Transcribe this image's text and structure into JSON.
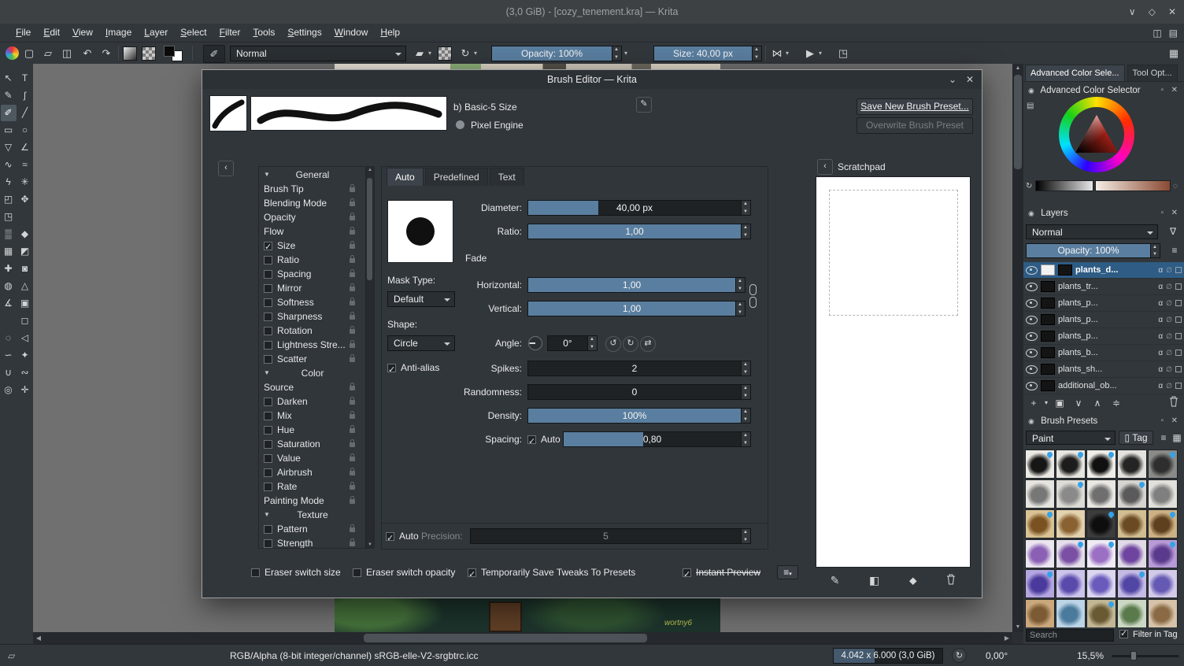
{
  "titlebar": {
    "title": "(3,0 GiB) - [cozy_tenement.kra] — Krita",
    "controls": {
      "shade": "∨",
      "maximize": "◇",
      "close": "✕"
    }
  },
  "menubar": {
    "items": [
      "File",
      "Edit",
      "View",
      "Image",
      "Layer",
      "Select",
      "Filter",
      "Tools",
      "Settings",
      "Window",
      "Help"
    ],
    "right_icons": {
      "detach": "◫",
      "canvas_only": "▤"
    }
  },
  "toolbar": {
    "icons": {
      "new": "▢",
      "open": "▱",
      "save": "◫",
      "undo": "↶",
      "redo": "↷",
      "eraser": "▰",
      "reload": "↻",
      "mirror_h": "⋈",
      "mirror_v": "▶",
      "wrap_around": "◳",
      "workspace": "▦",
      "brush_editor": "✐",
      "caret": "▾"
    },
    "blending_label": "Normal",
    "opacity": {
      "label": "Opacity: 100%",
      "fill": 1
    },
    "size": {
      "label": "Size: 40,00 px",
      "fill": 1
    }
  },
  "left_toolbar": {
    "tools": [
      {
        "name": "select-shapes",
        "glyph": "↖"
      },
      {
        "name": "text",
        "glyph": "T"
      },
      {
        "name": "edit-shapes",
        "glyph": "✎"
      },
      {
        "name": "calligraphy",
        "glyph": "ʃ"
      },
      {
        "name": "freehand-brush",
        "glyph": "✐",
        "selected": true
      },
      {
        "name": "line",
        "glyph": "╱"
      },
      {
        "name": "rectangle",
        "glyph": "▭"
      },
      {
        "name": "ellipse",
        "glyph": "○"
      },
      {
        "name": "polygon",
        "glyph": "▽"
      },
      {
        "name": "polyline",
        "glyph": "∠"
      },
      {
        "name": "bezier-curve",
        "glyph": "∿"
      },
      {
        "name": "freehand-path",
        "glyph": "≈"
      },
      {
        "name": "dynamic-brush",
        "glyph": "ϟ"
      },
      {
        "name": "multibrush",
        "glyph": "✳"
      },
      {
        "name": "transform",
        "glyph": "◰"
      },
      {
        "name": "move",
        "glyph": "✥"
      },
      {
        "name": "crop",
        "glyph": "◳"
      },
      {
        "name": "spacer-1",
        "glyph": ""
      },
      {
        "name": "gradient",
        "glyph": "▒"
      },
      {
        "name": "color-sampler",
        "glyph": "◆"
      },
      {
        "name": "pattern-edit",
        "glyph": "▦"
      },
      {
        "name": "colorize-mask",
        "glyph": "◩"
      },
      {
        "name": "smart-patch",
        "glyph": "✚"
      },
      {
        "name": "fill",
        "glyph": "◙"
      },
      {
        "name": "enclose-fill",
        "glyph": "◍"
      },
      {
        "name": "assistants",
        "glyph": "△"
      },
      {
        "name": "measure",
        "glyph": "∡"
      },
      {
        "name": "reference-images",
        "glyph": "▣"
      },
      {
        "name": "spacer-2",
        "glyph": ""
      },
      {
        "name": "rect-select",
        "glyph": "◻"
      },
      {
        "name": "ellipse-select",
        "glyph": "◌"
      },
      {
        "name": "polygon-select",
        "glyph": "◁"
      },
      {
        "name": "freehand-select",
        "glyph": "∽"
      },
      {
        "name": "similar-select",
        "glyph": "✦"
      },
      {
        "name": "magnetic-select",
        "glyph": "∪"
      },
      {
        "name": "bezier-select",
        "glyph": "∾"
      },
      {
        "name": "zoom",
        "glyph": "◎"
      },
      {
        "name": "pan",
        "glyph": "✛"
      }
    ]
  },
  "dialog": {
    "title": "Brush Editor — Krita",
    "controls": {
      "collapse": "⌄",
      "close": "✕"
    },
    "preset_name": "b) Basic-5 Size",
    "engine_label": "Pixel Engine",
    "save_button": "Save New Brush Preset...",
    "overwrite_button": "Overwrite Brush Preset",
    "collapse_arrow": "‹",
    "options": [
      {
        "kind": "section",
        "label": "General"
      },
      {
        "kind": "plain",
        "label": "Brush Tip"
      },
      {
        "kind": "plain",
        "label": "Blending Mode"
      },
      {
        "kind": "plain",
        "label": "Opacity"
      },
      {
        "kind": "plain",
        "label": "Flow"
      },
      {
        "kind": "check",
        "label": "Size",
        "checked": true
      },
      {
        "kind": "check",
        "label": "Ratio",
        "checked": false
      },
      {
        "kind": "check",
        "label": "Spacing",
        "checked": false
      },
      {
        "kind": "check",
        "label": "Mirror",
        "checked": false
      },
      {
        "kind": "check",
        "label": "Softness",
        "checked": false
      },
      {
        "kind": "check",
        "label": "Sharpness",
        "checked": false
      },
      {
        "kind": "check",
        "label": "Rotation",
        "checked": false
      },
      {
        "kind": "check",
        "label": "Lightness Stre...",
        "checked": false
      },
      {
        "kind": "check",
        "label": "Scatter",
        "checked": false
      },
      {
        "kind": "section",
        "label": "Color"
      },
      {
        "kind": "plain",
        "label": "Source"
      },
      {
        "kind": "check",
        "label": "Darken",
        "checked": false
      },
      {
        "kind": "check",
        "label": "Mix",
        "checked": false
      },
      {
        "kind": "check",
        "label": "Hue",
        "checked": false
      },
      {
        "kind": "check",
        "label": "Saturation",
        "checked": false
      },
      {
        "kind": "check",
        "label": "Value",
        "checked": false
      },
      {
        "kind": "check",
        "label": "Airbrush",
        "checked": false
      },
      {
        "kind": "check",
        "label": "Rate",
        "checked": false
      },
      {
        "kind": "plain",
        "label": "Painting Mode"
      },
      {
        "kind": "section",
        "label": "Texture"
      },
      {
        "kind": "check",
        "label": "Pattern",
        "checked": false
      },
      {
        "kind": "check",
        "label": "Strength",
        "checked": false
      }
    ],
    "tabs": {
      "items": [
        "Auto",
        "Predefined",
        "Text"
      ],
      "active": "Auto"
    },
    "fields": {
      "diameter": {
        "label": "Diameter:",
        "value": "40,00 px",
        "fill": 0.33
      },
      "ratio": {
        "label": "Ratio:",
        "value": "1,00",
        "fill": 1
      },
      "fade_label": "Fade",
      "mask_type_label": "Mask Type:",
      "mask_type": "Default",
      "horizontal": {
        "label": "Horizontal:",
        "value": "1,00",
        "fill": 1
      },
      "vertical": {
        "label": "Vertical:",
        "value": "1,00",
        "fill": 1
      },
      "shape_label": "Shape:",
      "shape": "Circle",
      "angle_label": "Angle:",
      "angle_value": "0°",
      "antialias_label": "Anti-alias",
      "spikes": {
        "label": "Spikes:",
        "value": "2",
        "fill": 0
      },
      "randomness": {
        "label": "Randomness:",
        "value": "0",
        "fill": 0
      },
      "density": {
        "label": "Density:",
        "value": "100%",
        "fill": 1
      },
      "spacing": {
        "label": "Spacing:",
        "auto_label": "Auto",
        "value": "0,80",
        "fill": 0.45
      },
      "auto_label": "Auto",
      "precision_label": "Precision:",
      "precision": {
        "value": "5",
        "fill": 0
      }
    },
    "footer": {
      "eraser_switch_size": "Eraser switch size",
      "eraser_switch_opacity": "Eraser switch opacity",
      "save_tweaks": "Temporarily Save Tweaks To Presets",
      "instant_preview": "Instant Preview"
    },
    "scratchpad": {
      "title": "Scratchpad",
      "collapse_arrow": "‹"
    }
  },
  "right_dock": {
    "tabs": {
      "active": "Advanced Color Sele...",
      "inactive": "Tool Opt..."
    },
    "color_selector": {
      "title": "Advanced Color Selector"
    },
    "layers": {
      "title": "Layers",
      "blending": "Normal",
      "opacity": {
        "label": "Opacity: 100%",
        "fill": 1
      },
      "rows": [
        {
          "name": "plants_d...",
          "selected": true
        },
        {
          "name": "plants_tr...",
          "selected": false
        },
        {
          "name": "plants_p...",
          "selected": false
        },
        {
          "name": "plants_p...",
          "selected": false
        },
        {
          "name": "plants_p...",
          "selected": false
        },
        {
          "name": "plants_b...",
          "selected": false
        },
        {
          "name": "plants_sh...",
          "selected": false
        },
        {
          "name": "additional_ob...",
          "selected": false
        }
      ]
    },
    "brush_presets": {
      "title": "Brush Presets",
      "tag_filter": "Paint",
      "tag_button": "Tag",
      "search_placeholder": "Search",
      "filter_label": "Filter in Tag",
      "filter_checked": true,
      "thumbnails": [
        {
          "bg": "#ebe9e4",
          "blob": "#161616",
          "drop": true
        },
        {
          "bg": "#e7e5e0",
          "blob": "#1c1c1c",
          "drop": true
        },
        {
          "bg": "#efede8",
          "blob": "#101010",
          "drop": true
        },
        {
          "bg": "#e4e2dd",
          "blob": "#242424",
          "drop": false
        },
        {
          "bg": "#8a8a88",
          "blob": "#2e2e2e",
          "drop": true
        },
        {
          "bg": "#e6e4df",
          "blob": "#777777",
          "drop": false
        },
        {
          "bg": "#dddbd6",
          "blob": "#8a8a8a",
          "drop": true
        },
        {
          "bg": "#e9e7e2",
          "blob": "#6f6f6f",
          "drop": false
        },
        {
          "bg": "#d6d4cf",
          "blob": "#5a5a5a",
          "drop": true
        },
        {
          "bg": "#e2e0db",
          "blob": "#7f7f7f",
          "drop": false
        },
        {
          "bg": "#d9c294",
          "blob": "#7a5222",
          "drop": true
        },
        {
          "bg": "#e3d2ae",
          "blob": "#8a6232",
          "drop": false
        },
        {
          "bg": "#3c3c3c",
          "blob": "#0e0e0e",
          "drop": true
        },
        {
          "bg": "#d2bd90",
          "blob": "#6a4a22",
          "drop": false
        },
        {
          "bg": "#cdb184",
          "blob": "#5e3f1e",
          "drop": true
        },
        {
          "bg": "#eae5ef",
          "blob": "#8a5fb4",
          "drop": false
        },
        {
          "bg": "#e4deea",
          "blob": "#7a4fa4",
          "drop": true
        },
        {
          "bg": "#efeaf4",
          "blob": "#9a6fc4",
          "drop": true
        },
        {
          "bg": "#e0dae6",
          "blob": "#6f44a0",
          "drop": false
        },
        {
          "bg": "#b89ad6",
          "blob": "#5a3a8c",
          "drop": true
        },
        {
          "bg": "#b4a6e0",
          "blob": "#4a3a9c",
          "drop": true
        },
        {
          "bg": "#ccc4ea",
          "blob": "#5a4aac",
          "drop": false
        },
        {
          "bg": "#dcd6f0",
          "blob": "#6a5abc",
          "drop": false
        },
        {
          "bg": "#c4bae4",
          "blob": "#5246a4",
          "drop": true
        },
        {
          "bg": "#d2cae8",
          "blob": "#645ab4",
          "drop": false
        },
        {
          "bg": "#caa87c",
          "blob": "#7c5a33",
          "drop": false
        },
        {
          "bg": "#bcd4e6",
          "blob": "#4a7a9c",
          "drop": false
        },
        {
          "bg": "#c2b694",
          "blob": "#6a5a33",
          "drop": true
        },
        {
          "bg": "#ccd8c4",
          "blob": "#5a7a4c",
          "drop": false
        },
        {
          "bg": "#d6c2a8",
          "blob": "#8a6a44",
          "drop": false
        }
      ]
    }
  },
  "statusbar": {
    "profile": "RGB/Alpha (8-bit integer/channel)  sRGB-elle-V2-srgbtrc.icc",
    "dimensions": "4.042 x 6.000 (3,0 GiB)",
    "mem_fill": 0.38,
    "angle": "0,00°",
    "zoom": "15,5%"
  },
  "artwork": {
    "signature": "wortny6"
  }
}
